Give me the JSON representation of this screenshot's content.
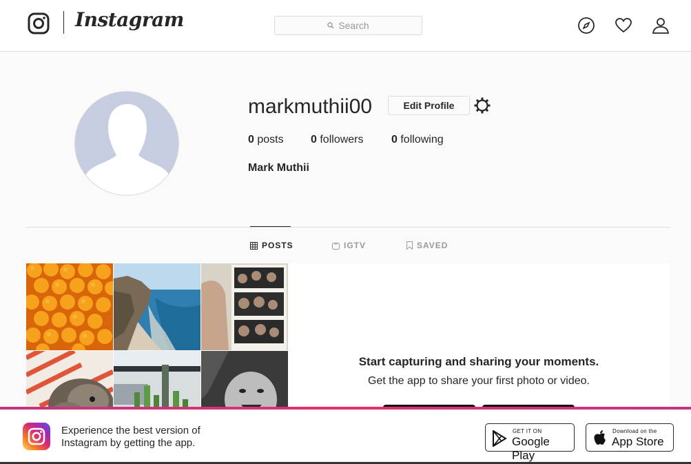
{
  "header": {
    "brand": "Instagram",
    "search_placeholder": "Search",
    "icons": [
      "explore-icon",
      "activity-heart-icon",
      "profile-icon"
    ]
  },
  "profile": {
    "username": "markmuthii00",
    "edit_label": "Edit Profile",
    "stats": [
      {
        "count": "0",
        "label": "posts"
      },
      {
        "count": "0",
        "label": "followers"
      },
      {
        "count": "0",
        "label": "following"
      }
    ],
    "full_name": "Mark Muthii"
  },
  "tabs": [
    {
      "label": "POSTS",
      "icon": "grid-icon",
      "active": true
    },
    {
      "label": "IGTV",
      "icon": "igtv-icon",
      "active": false
    },
    {
      "label": "SAVED",
      "icon": "bookmark-icon",
      "active": false
    }
  ],
  "promo": {
    "title": "Start capturing and sharing your moments.",
    "subtitle": "Get the app to share your first photo or video."
  },
  "banner": {
    "text": "Experience the best version of Instagram by getting the app.",
    "google_small": "GET IT ON",
    "google_big": "Google Play",
    "apple_small": "Download on the",
    "apple_big": "App Store"
  },
  "colors": {
    "accent_gradient_start": "#c13584",
    "border": "#dbdbdb",
    "text": "#262626",
    "muted": "#999999"
  }
}
